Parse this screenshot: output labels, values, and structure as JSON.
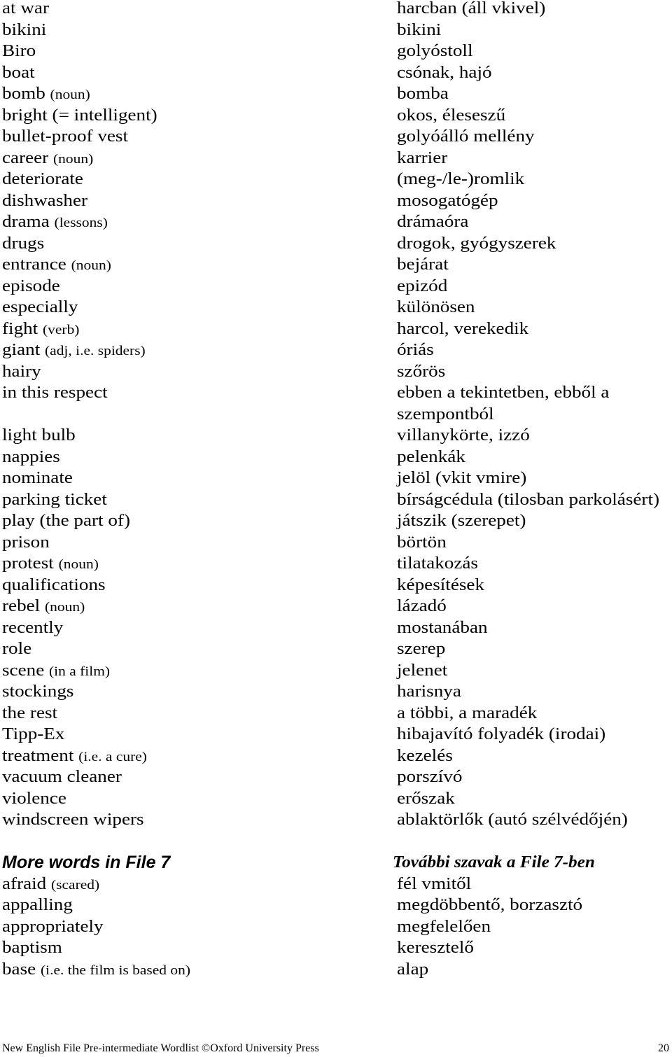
{
  "rows": [
    {
      "en": "at war",
      "note": "",
      "hu": "harcban (áll vkivel)"
    },
    {
      "en": "bikini",
      "note": "",
      "hu": "bikini"
    },
    {
      "en": "Biro",
      "note": "",
      "hu": "golyóstoll"
    },
    {
      "en": "boat",
      "note": "",
      "hu": "csónak, hajó"
    },
    {
      "en": "bomb",
      "note": "(noun)",
      "hu": "bomba"
    },
    {
      "en": "bright (= intelligent)",
      "note": "",
      "hu": "okos, éleseszű"
    },
    {
      "en": "bullet-proof vest",
      "note": "",
      "hu": "golyóálló mellény"
    },
    {
      "en": "career",
      "note": "(noun)",
      "hu": "karrier"
    },
    {
      "en": "deteriorate",
      "note": "",
      "hu": "(meg-/le-)romlik"
    },
    {
      "en": "dishwasher",
      "note": "",
      "hu": "mosogatógép"
    },
    {
      "en": "drama",
      "note": "(lessons)",
      "hu": "drámaóra"
    },
    {
      "en": "drugs",
      "note": "",
      "hu": "drogok, gyógyszerek"
    },
    {
      "en": "entrance",
      "note": "(noun)",
      "hu": "bejárat"
    },
    {
      "en": "episode",
      "note": "",
      "hu": "epizód"
    },
    {
      "en": "especially",
      "note": "",
      "hu": "különösen"
    },
    {
      "en": "fight",
      "note": "(verb)",
      "hu": "harcol, verekedik"
    },
    {
      "en": "giant",
      "note": "(adj, i.e. spiders)",
      "hu": "óriás"
    },
    {
      "en": "hairy",
      "note": "",
      "hu": "szőrös"
    },
    {
      "en": "in this respect",
      "note": "",
      "hu": "ebben a tekintetben, ebből a"
    },
    {
      "en": "",
      "note": "",
      "hu": "szempontból"
    },
    {
      "en": "light bulb",
      "note": "",
      "hu": "villanykörte, izzó"
    },
    {
      "en": "nappies",
      "note": "",
      "hu": "pelenkák"
    },
    {
      "en": "nominate",
      "note": "",
      "hu": "jelöl (vkit vmire)"
    },
    {
      "en": "parking ticket",
      "note": "",
      "hu": "bírságcédula (tilosban parkolásért)"
    },
    {
      "en": "play (the part of)",
      "note": "",
      "hu": "játszik (szerepet)"
    },
    {
      "en": "prison",
      "note": "",
      "hu": "börtön"
    },
    {
      "en": "protest",
      "note": "(noun)",
      "hu": "tilatakozás"
    },
    {
      "en": "qualifications",
      "note": "",
      "hu": "képesítések"
    },
    {
      "en": "rebel",
      "note": "(noun)",
      "hu": "lázadó"
    },
    {
      "en": "recently",
      "note": "",
      "hu": "mostanában"
    },
    {
      "en": "role",
      "note": "",
      "hu": "szerep"
    },
    {
      "en": "scene",
      "note": "(in a film)",
      "hu": "jelenet"
    },
    {
      "en": "stockings",
      "note": "",
      "hu": "harisnya"
    },
    {
      "en": "the rest",
      "note": "",
      "hu": "a többi, a maradék"
    },
    {
      "en": "Tipp-Ex",
      "note": "",
      "hu": "hibajavító folyadék (irodai)"
    },
    {
      "en": "treatment",
      "note": "(i.e. a cure)",
      "hu": "kezelés"
    },
    {
      "en": "vacuum cleaner",
      "note": "",
      "hu": "porszívó"
    },
    {
      "en": "violence",
      "note": "",
      "hu": "erőszak"
    },
    {
      "en": "windscreen wipers",
      "note": "",
      "hu": "ablaktörlők (autó szélvédőjén)"
    }
  ],
  "section": {
    "heading_en": "More words in File 7",
    "heading_hu": "További szavak a File 7-ben",
    "rows": [
      {
        "en": "afraid",
        "note": "(scared)",
        "hu": "fél vmitől"
      },
      {
        "en": "appalling",
        "note": "",
        "hu": "megdöbbentő, borzasztó"
      },
      {
        "en": "appropriately",
        "note": "",
        "hu": "megfelelően"
      },
      {
        "en": "baptism",
        "note": "",
        "hu": "keresztelő"
      },
      {
        "en": "base",
        "note": "(i.e. the film is based on)",
        "hu": "alap"
      }
    ]
  },
  "footer": {
    "text": "New English File Pre-intermediate Wordlist ©Oxford University Press",
    "page_number": "20"
  }
}
